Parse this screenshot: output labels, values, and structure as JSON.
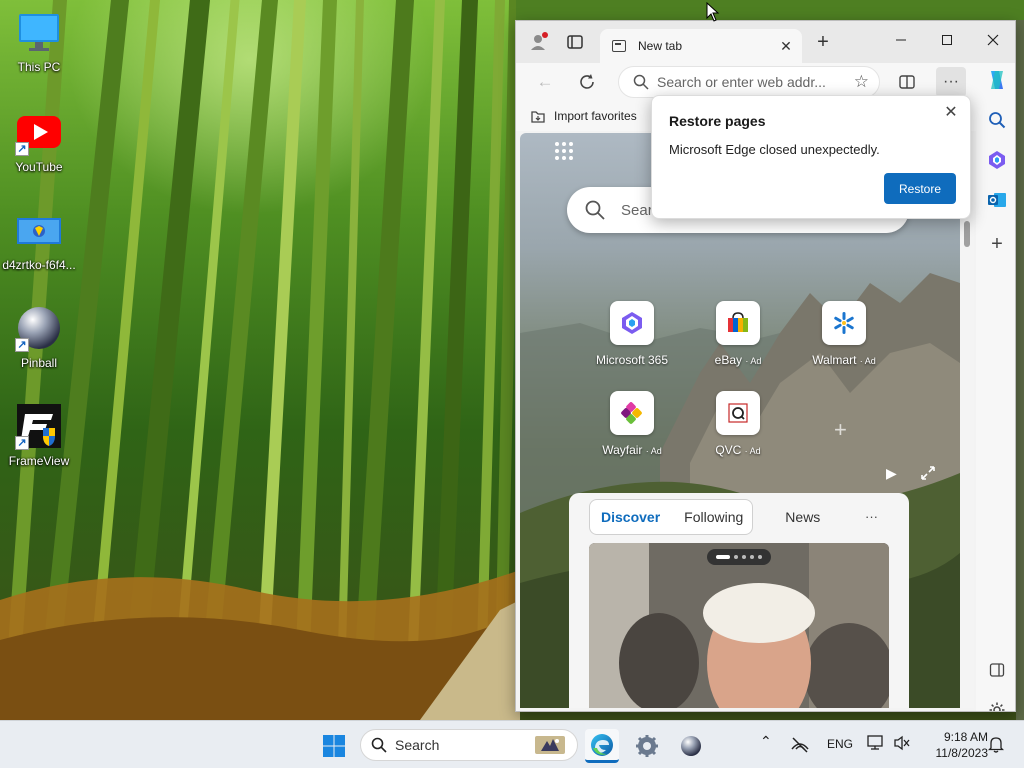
{
  "desktop": {
    "icons": [
      {
        "label": "This PC",
        "icon": "monitor-icon"
      },
      {
        "label": "YouTube",
        "icon": "youtube-icon"
      },
      {
        "label": "d4zrtko-f6f4...",
        "icon": "image-file-icon"
      },
      {
        "label": "Pinball",
        "icon": "pinball-icon"
      },
      {
        "label": "FrameView",
        "icon": "frameview-icon"
      }
    ]
  },
  "browser": {
    "tab_title": "New tab",
    "address_placeholder": "Search or enter web addr...",
    "favorites": {
      "import_label": "Import favorites"
    },
    "ntp": {
      "search_placeholder": "Sear",
      "apps": [
        {
          "label": "Microsoft 365",
          "ad": ""
        },
        {
          "label": "eBay",
          "ad": "· Ad"
        },
        {
          "label": "Walmart",
          "ad": "· Ad"
        },
        {
          "label": "Wayfair",
          "ad": "· Ad"
        },
        {
          "label": "QVC",
          "ad": "· Ad"
        }
      ],
      "feed_tabs": [
        "Discover",
        "Following",
        "News"
      ],
      "feed_more": "···"
    },
    "popup": {
      "title": "Restore pages",
      "message": "Microsoft Edge closed unexpectedly.",
      "button": "Restore"
    }
  },
  "taskbar": {
    "search_placeholder": "Search",
    "language": "ENG",
    "time": "9:18 AM",
    "date": "11/8/2023"
  },
  "colors": {
    "accent": "#0f6cbd",
    "taskbar": "#e9edf2"
  }
}
